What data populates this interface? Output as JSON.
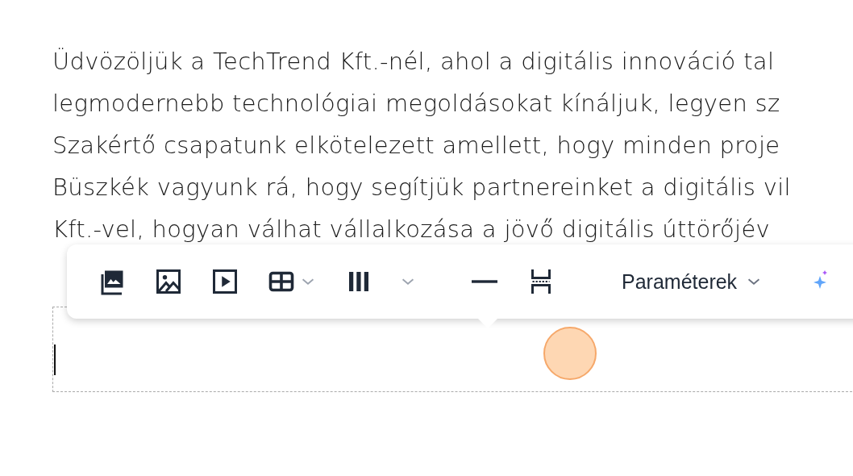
{
  "paragraph": {
    "lines": [
      "Üdvözöljük a TechTrend Kft.-nél, ahol a digitális innováció tal",
      "legmodernebb technológiai megoldásokat kínáljuk, legyen sz",
      "Szakértő csapatunk elkötelezett amellett, hogy minden proje",
      "Büszkék vagyunk rá, hogy segítjük partnereinket a digitális vil",
      "Kft.-vel, hogyan válhat vállalkozása a jövő digitális úttörőjév"
    ]
  },
  "toolbar": {
    "parameters_dropdown": {
      "label": "Paraméterek"
    }
  }
}
